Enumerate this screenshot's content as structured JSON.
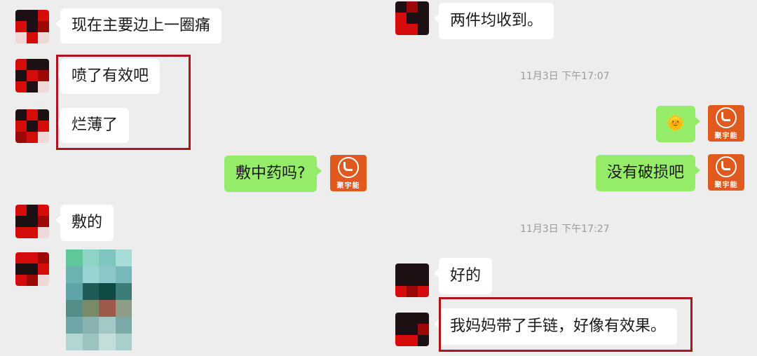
{
  "left_panel": {
    "messages": [
      {
        "text": "现在主要边上一圈痛",
        "side": "in"
      },
      {
        "text": "喷了有效吧",
        "side": "in"
      },
      {
        "text": "烂薄了",
        "side": "in"
      },
      {
        "text": "敷中药吗?",
        "side": "out"
      },
      {
        "text": "敷的",
        "side": "in"
      }
    ],
    "image_message": {
      "kind": "pixelated-photo"
    }
  },
  "right_panel": {
    "top_message": {
      "text": "两件均收到。",
      "side": "in"
    },
    "timestamp_1": "11月3日 下午17:07",
    "emoji_message": {
      "icon": "sun-face-emoji",
      "glyph": "🌞",
      "side": "out"
    },
    "message_2": {
      "text": "没有破损吧",
      "side": "out"
    },
    "timestamp_2": "11月3日 下午17:27",
    "message_3": {
      "text": "好的",
      "side": "in"
    },
    "message_4": {
      "text": "我妈妈带了手链，好像有效果。",
      "side": "in"
    }
  },
  "brand_avatar": {
    "name": "聚宇能"
  },
  "colors": {
    "outgoing_bubble": "#95ec69",
    "incoming_bubble": "#ffffff",
    "highlight_border": "#b0141a",
    "brand_orange": "#e05a1f",
    "background": "#ededed"
  }
}
